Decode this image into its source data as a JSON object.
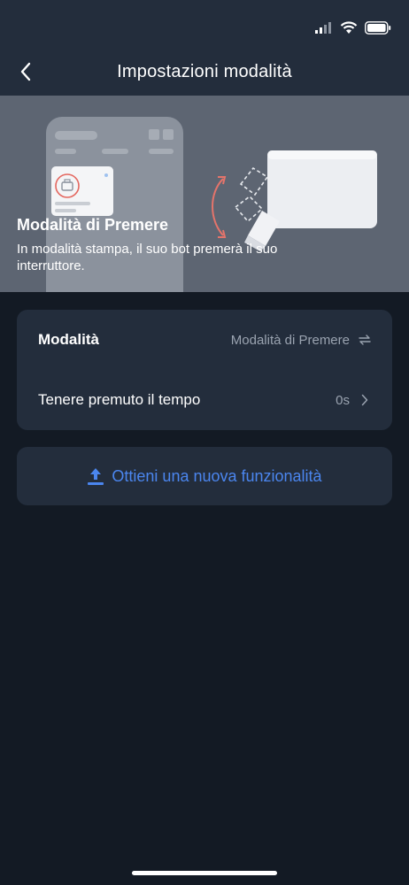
{
  "header": {
    "title": "Impostazioni modalità"
  },
  "hero": {
    "title": "Modalità di Premere",
    "description": "In modalità stampa, il suo bot premerà il suo interruttore."
  },
  "settings": {
    "rows": [
      {
        "label": "Modalità",
        "value": "Modalità di Premere",
        "icon": "swap-arrows-icon"
      },
      {
        "label": "Tenere premuto il tempo",
        "value": "0s",
        "icon": "chevron-right-icon"
      }
    ]
  },
  "upgrade": {
    "label": "Ottieni una nuova funzionalità",
    "icon": "upload-icon"
  },
  "colors": {
    "background": "#131a24",
    "card": "#232d3c",
    "accent": "#4b86ef",
    "muted_text": "#9aa3b0"
  }
}
